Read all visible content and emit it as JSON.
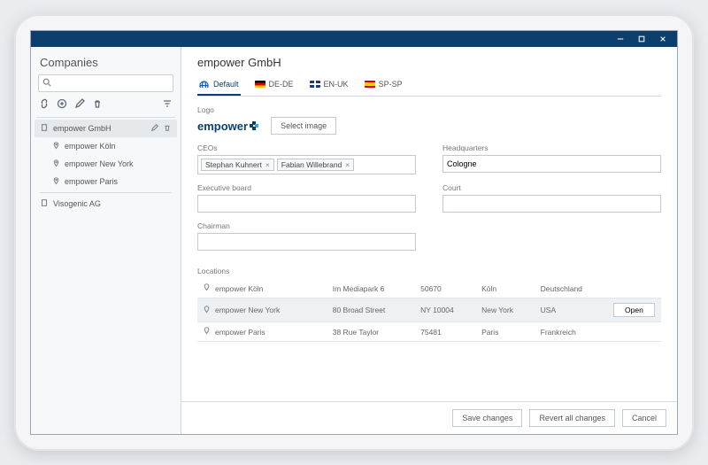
{
  "window": {
    "minimize": "–",
    "maximize": "☐",
    "close": "✕"
  },
  "sidebar": {
    "title": "Companies",
    "search": {
      "placeholder": ""
    },
    "items": [
      {
        "label": "empower GmbH",
        "kind": "company",
        "selected": true
      },
      {
        "label": "empower Köln",
        "kind": "location"
      },
      {
        "label": "empower New York",
        "kind": "location"
      },
      {
        "label": "empower Paris",
        "kind": "location"
      },
      {
        "label": "Visogenic AG",
        "kind": "company"
      }
    ]
  },
  "header": {
    "title": "empower GmbH",
    "tabs": [
      {
        "label": "Default",
        "flag": "globe",
        "active": true
      },
      {
        "label": "DE-DE",
        "flag": "de"
      },
      {
        "label": "EN-UK",
        "flag": "uk"
      },
      {
        "label": "SP-SP",
        "flag": "sp"
      }
    ]
  },
  "logo": {
    "label": "Logo",
    "brand_text": "empower",
    "select_button": "Select image"
  },
  "fields": {
    "ceos_label": "CEOs",
    "ceos": [
      "Stephan Kuhnert",
      "Fabian Willebrand"
    ],
    "exec_board_label": "Executive board",
    "chairman_label": "Chairman",
    "hq_label": "Headquarters",
    "hq_value": "Cologne",
    "court_label": "Court"
  },
  "locations": {
    "label": "Locations",
    "open_button": "Open",
    "rows": [
      {
        "name": "empower Köln",
        "street": "Im Mediapark 6",
        "zip": "50670",
        "city": "Köln",
        "country": "Deutschland"
      },
      {
        "name": "empower New York",
        "street": "80 Broad Street",
        "zip": "NY 10004",
        "city": "New York",
        "country": "USA",
        "selected": true
      },
      {
        "name": "empower Paris",
        "street": "38 Rue Taylor",
        "zip": "75481",
        "city": "Paris",
        "country": "Frankreich"
      }
    ]
  },
  "footer": {
    "save": "Save changes",
    "revert": "Revert all changes",
    "cancel": "Cancel"
  }
}
